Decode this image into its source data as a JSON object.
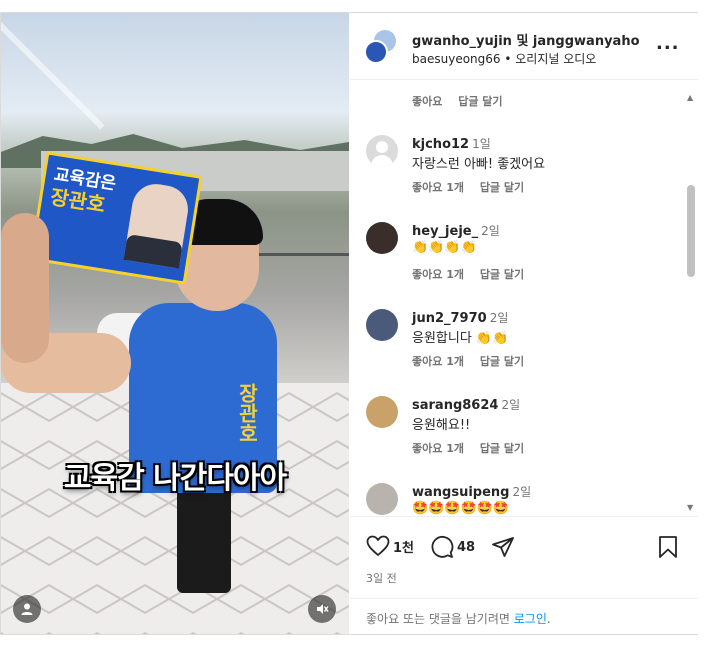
{
  "post": {
    "header": {
      "names": "gwanho_yujin 및 janggwanyaho",
      "audio": "baesuyeong66 • 오리지널 오디오",
      "more": "..."
    },
    "media": {
      "caption": "교육감 나간다아아",
      "card_line1": "교육감은",
      "card_line2": "장관호",
      "vest_text": "장관호"
    },
    "top_reply": {
      "like": "좋아요",
      "reply": "답글 달기"
    },
    "comments": [
      {
        "user": "kjcho12",
        "time": "1일",
        "text": "자랑스런 아빠! 좋겠어요",
        "likes": "좋아요 1개",
        "reply": "답글 달기",
        "avatar": "default-avatar"
      },
      {
        "user": "hey_jeje_",
        "time": "2일",
        "text": "👏👏👏👏",
        "likes": "좋아요 1개",
        "reply": "답글 달기",
        "avatar": "photo-avatar"
      },
      {
        "user": "jun2_7970",
        "time": "2일",
        "text": "응원합니다 👏👏",
        "likes": "좋아요 1개",
        "reply": "답글 달기",
        "avatar": "photo-avatar"
      },
      {
        "user": "sarang8624",
        "time": "2일",
        "text": "응원해요!!",
        "likes": "좋아요 1개",
        "reply": "답글 달기",
        "avatar": "photo-avatar"
      },
      {
        "user": "wangsuipeng",
        "time": "2일",
        "text": "🤩🤩🤩🤩🤩🤩",
        "likes": "",
        "reply": "",
        "avatar": "photo-avatar"
      }
    ],
    "stats": {
      "likes": "1천",
      "comments": "48"
    },
    "date": "3일 전",
    "login_prompt": "좋아요 또는 댓글을 남기려면 ",
    "login_link": "로그인",
    "login_suffix": "."
  },
  "colors": {
    "link": "#0095f6",
    "muted": "#737373",
    "text": "#262626"
  }
}
